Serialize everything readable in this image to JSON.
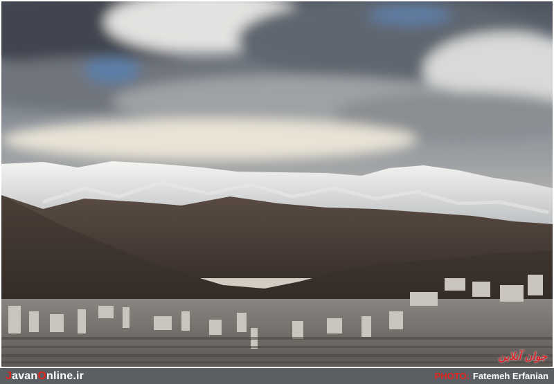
{
  "photo": {
    "alt": "Snow-capped mountains behind a city skyline under a cloudy sky",
    "watermark": "جوان آنلاین"
  },
  "footer": {
    "brand": {
      "j": "J",
      "part1": "avan",
      "o": "O",
      "part2": "nline.ir"
    },
    "credit_label": "PHOTO:",
    "credit_name": "Fatemeh Erfanian"
  },
  "colors": {
    "footer_bg": "#5b5e62",
    "accent_red": "#e2231a",
    "footer_text": "#ffffff"
  }
}
